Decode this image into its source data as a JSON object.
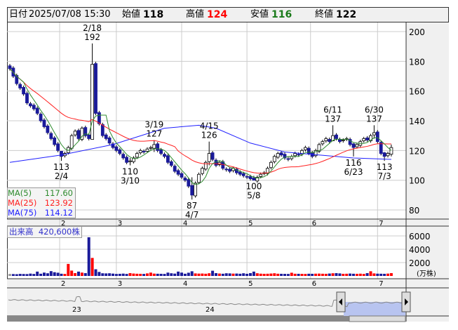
{
  "header": {
    "date_label": "日付",
    "datetime": "2025/07/08 15:30",
    "open_label": "始値",
    "open": "118",
    "high_label": "高値",
    "high": "124",
    "low_label": "安値",
    "low": "116",
    "close_label": "終値",
    "close": "122"
  },
  "legend": {
    "ma5_label": "MA(5)",
    "ma5": "117.60",
    "ma25_label": "MA(25)",
    "ma25": "123.92",
    "ma75_label": "MA(75)",
    "ma75": "114.12"
  },
  "volume": {
    "label": "出来高",
    "value": "420,600株",
    "unit": "(万株)"
  },
  "colors": {
    "up": "#ffffff",
    "down": "#1a1a9a",
    "vol_up": "#ff0000",
    "vol_down": "#1a1a9a",
    "vol_flat": "#999999",
    "ma5": "#2e8b2e",
    "ma25": "#ff2020",
    "ma75": "#2020ff"
  },
  "chart_data": {
    "type": "candlestick",
    "ylim": [
      75,
      205
    ],
    "yticks": [
      "200",
      "180",
      "160",
      "140",
      "120",
      "100",
      "80"
    ],
    "vol_ticks": [
      "6000",
      "4000",
      "2000"
    ],
    "vol_max": 6500,
    "months": [
      {
        "label": "2",
        "i": 14.5
      },
      {
        "label": "3",
        "i": 31
      },
      {
        "label": "4",
        "i": 50
      },
      {
        "label": "5",
        "i": 69
      },
      {
        "label": "6",
        "i": 87.5
      },
      {
        "label": "7",
        "i": 107
      }
    ],
    "close": [
      175,
      170,
      165,
      162,
      158,
      152,
      150,
      148,
      145,
      140,
      136,
      132,
      128,
      124,
      120,
      116,
      118,
      122,
      130,
      133,
      128,
      135,
      130,
      128,
      178,
      145,
      138,
      130,
      128,
      125,
      122,
      120,
      118,
      115,
      112,
      113,
      115,
      118,
      120,
      119,
      121,
      122,
      124,
      120,
      118,
      116,
      112,
      110,
      106,
      104,
      102,
      100,
      96,
      90,
      98,
      104,
      108,
      112,
      118,
      114,
      110,
      112,
      108,
      107,
      106,
      108,
      105,
      104,
      103,
      102,
      101,
      100,
      102,
      104,
      105,
      108,
      112,
      116,
      118,
      117,
      115,
      114,
      116,
      118,
      117,
      120,
      122,
      118,
      116,
      120,
      124,
      126,
      128,
      126,
      130,
      128,
      126,
      127,
      128,
      124,
      122,
      124,
      126,
      128,
      127,
      130,
      132,
      126,
      118,
      116,
      118,
      122
    ],
    "extremes": {
      "24": [
        192,
        130
      ],
      "53": [
        102,
        87
      ],
      "15": [
        119,
        113
      ],
      "35": [
        115,
        110
      ],
      "42": [
        127,
        119
      ],
      "58": [
        126,
        110
      ],
      "71": [
        103,
        100
      ],
      "94": [
        137,
        127
      ],
      "100": [
        125,
        116
      ],
      "106": [
        137,
        128
      ],
      "109": [
        119,
        113
      ],
      "111": [
        124,
        116
      ]
    },
    "volume": [
      300,
      280,
      260,
      310,
      290,
      280,
      350,
      300,
      650,
      330,
      500,
      400,
      720,
      560,
      480,
      330,
      300,
      1800,
      800,
      420,
      650,
      500,
      420,
      5800,
      2700,
      1000,
      600,
      400,
      380,
      400,
      350,
      300,
      320,
      350,
      300,
      420,
      360,
      330,
      320,
      300,
      380,
      500,
      350,
      330,
      320,
      300,
      500,
      400,
      350,
      650,
      500,
      330,
      480,
      700,
      380,
      350,
      360,
      330,
      400,
      780,
      420,
      360,
      330,
      400,
      380,
      350,
      360,
      330,
      400,
      320,
      420,
      650,
      400,
      340,
      320,
      330,
      360,
      400,
      330,
      320,
      310,
      300,
      480,
      330,
      320,
      310,
      300,
      330,
      320,
      340,
      350,
      330,
      320,
      360,
      400,
      420,
      380,
      320,
      330,
      360,
      330,
      320,
      340,
      300,
      420,
      700,
      380,
      340,
      330,
      320,
      350,
      420
    ],
    "ma75": [
      [
        0,
        112
      ],
      [
        15,
        117
      ],
      [
        30,
        124
      ],
      [
        45,
        135
      ],
      [
        55,
        137
      ],
      [
        60,
        135
      ],
      [
        70,
        125
      ],
      [
        80,
        119
      ],
      [
        90,
        117
      ],
      [
        100,
        115
      ],
      [
        111,
        114
      ]
    ],
    "annotations": [
      {
        "i": 24,
        "date": "2/18",
        "value": "192",
        "pos": "above"
      },
      {
        "i": 15,
        "date": "2/4",
        "value": "113",
        "pos": "below"
      },
      {
        "i": 35,
        "date": "3/10",
        "value": "110",
        "pos": "below"
      },
      {
        "i": 42,
        "date": "3/19",
        "value": "127",
        "pos": "above"
      },
      {
        "i": 53,
        "date": "4/7",
        "value": "87",
        "pos": "below"
      },
      {
        "i": 58,
        "date": "4/15",
        "value": "126",
        "pos": "above"
      },
      {
        "i": 71,
        "date": "5/8",
        "value": "100",
        "pos": "below"
      },
      {
        "i": 94,
        "date": "6/11",
        "value": "137",
        "pos": "above"
      },
      {
        "i": 100,
        "date": "6/23",
        "value": "116",
        "pos": "below"
      },
      {
        "i": 106,
        "date": "6/30",
        "value": "137",
        "pos": "above"
      },
      {
        "i": 109,
        "date": "7/3",
        "value": "113",
        "pos": "below"
      }
    ],
    "navigator": {
      "labels": [
        "23",
        "24"
      ]
    }
  }
}
